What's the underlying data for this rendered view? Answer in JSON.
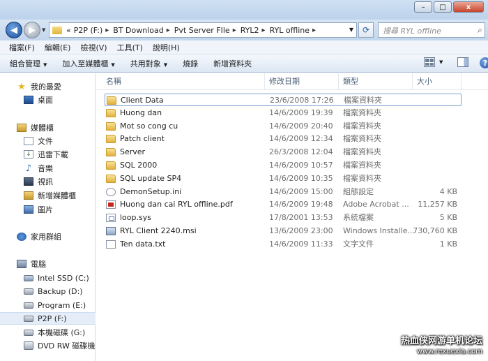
{
  "window": {
    "minimize": "–",
    "maximize": "□",
    "close": "x"
  },
  "address": {
    "prefix": "«",
    "crumbs": [
      "P2P (F:)",
      "BT Download",
      "Pvt Server FIle",
      "RYL2",
      "RYL offline"
    ],
    "separator": "▸",
    "search_placeholder": "搜尋 RYL offline"
  },
  "menu": [
    "檔案(F)",
    "編輯(E)",
    "檢視(V)",
    "工具(T)",
    "說明(H)"
  ],
  "toolbar": {
    "organize": "組合管理",
    "add_to_library": "加入至媒體櫃",
    "share": "共用對象",
    "burn": "燒錄",
    "new_folder": "新增資料夾"
  },
  "nav": {
    "favorites": "我的最愛",
    "desktop": "桌面",
    "libraries": "媒體櫃",
    "documents": "文件",
    "thunder": "迅雷下載",
    "music": "音樂",
    "videos": "視訊",
    "new_library": "新增媒體櫃",
    "pictures": "圖片",
    "homegroup": "家用群組",
    "computer": "電腦",
    "drives": [
      "Intel SSD (C:)",
      "Backup (D:)",
      "Program (E:)",
      "P2P (F:)",
      "本機磁碟 (G:)",
      "DVD RW 磁碟機 ("
    ]
  },
  "columns": {
    "name": "名稱",
    "date": "修改日期",
    "type": "類型",
    "size": "大小"
  },
  "files": [
    {
      "name": "Client Data",
      "date": "23/6/2008 17:26",
      "type": "檔案資料夾",
      "size": "",
      "icon": "folder"
    },
    {
      "name": "Huong dan",
      "date": "14/6/2009 19:39",
      "type": "檔案資料夾",
      "size": "",
      "icon": "folder"
    },
    {
      "name": "Mot so cong cu",
      "date": "14/6/2009 20:40",
      "type": "檔案資料夾",
      "size": "",
      "icon": "folder"
    },
    {
      "name": "Patch client",
      "date": "14/6/2009 12:34",
      "type": "檔案資料夾",
      "size": "",
      "icon": "folder"
    },
    {
      "name": "Server",
      "date": "26/3/2008 12:04",
      "type": "檔案資料夾",
      "size": "",
      "icon": "folder"
    },
    {
      "name": "SQL 2000",
      "date": "14/6/2009 10:57",
      "type": "檔案資料夾",
      "size": "",
      "icon": "folder"
    },
    {
      "name": "SQL update SP4",
      "date": "14/6/2009 10:35",
      "type": "檔案資料夾",
      "size": "",
      "icon": "folder"
    },
    {
      "name": "DemonSetup.ini",
      "date": "14/6/2009 15:00",
      "type": "組態設定",
      "size": "4 KB",
      "icon": "ini"
    },
    {
      "name": "Huong dan cai RYL offline.pdf",
      "date": "14/6/2009 19:48",
      "type": "Adobe Acrobat ...",
      "size": "11,257 KB",
      "icon": "pdf"
    },
    {
      "name": "loop.sys",
      "date": "17/8/2001 13:53",
      "type": "系統檔案",
      "size": "5 KB",
      "icon": "sys"
    },
    {
      "name": "RYL Client 2240.msi",
      "date": "13/6/2009 23:00",
      "type": "Windows Installe...",
      "size": "730,760 KB",
      "icon": "msi"
    },
    {
      "name": "Ten data.txt",
      "date": "14/6/2009 11:33",
      "type": "文字文件",
      "size": "1 KB",
      "icon": "txt"
    }
  ],
  "watermark": {
    "line1": "热血侠网游单机论坛",
    "line2": "www.rexuexia.com"
  }
}
